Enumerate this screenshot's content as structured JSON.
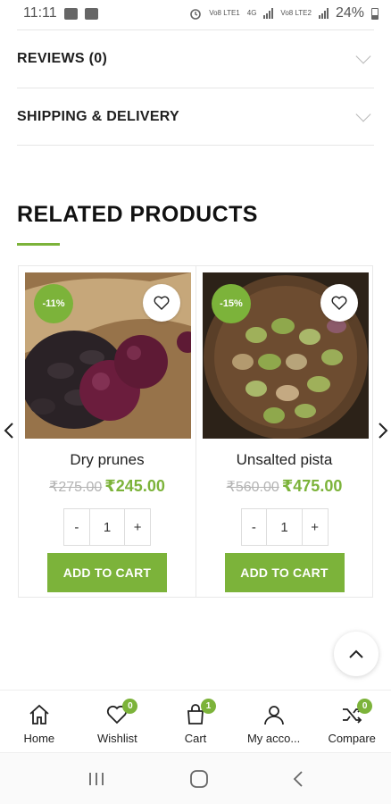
{
  "status": {
    "time": "11:11",
    "battery": "24%",
    "net1": "Vo8 LTE1",
    "net2": "4G",
    "net3": "Vo8 LTE2"
  },
  "accordions": [
    {
      "label": "REVIEWS (0)"
    },
    {
      "label": "SHIPPING & DELIVERY"
    }
  ],
  "related": {
    "title": "RELATED PRODUCTS",
    "products": [
      {
        "name": "Dry prunes",
        "discount": "-11%",
        "old_price": "₹275.00",
        "new_price": "₹245.00",
        "qty_minus": "-",
        "qty": "1",
        "qty_plus": "+",
        "button": "ADD TO CART"
      },
      {
        "name": "Unsalted pista",
        "discount": "-15%",
        "old_price": "₹560.00",
        "new_price": "₹475.00",
        "qty_minus": "-",
        "qty": "1",
        "qty_plus": "+",
        "button": "ADD TO CART"
      }
    ]
  },
  "bottom_nav": [
    {
      "label": "Home",
      "icon": "home-icon"
    },
    {
      "label": "Wishlist",
      "icon": "heart-icon",
      "count": "0"
    },
    {
      "label": "Cart",
      "icon": "shopping-bag-icon",
      "count": "1"
    },
    {
      "label": "My acco...",
      "icon": "user-icon"
    },
    {
      "label": "Compare",
      "icon": "shuffle-icon",
      "count": "0"
    }
  ],
  "colors": {
    "accent": "#7cb33a",
    "text": "#222222",
    "muted": "#b3b3b3"
  }
}
